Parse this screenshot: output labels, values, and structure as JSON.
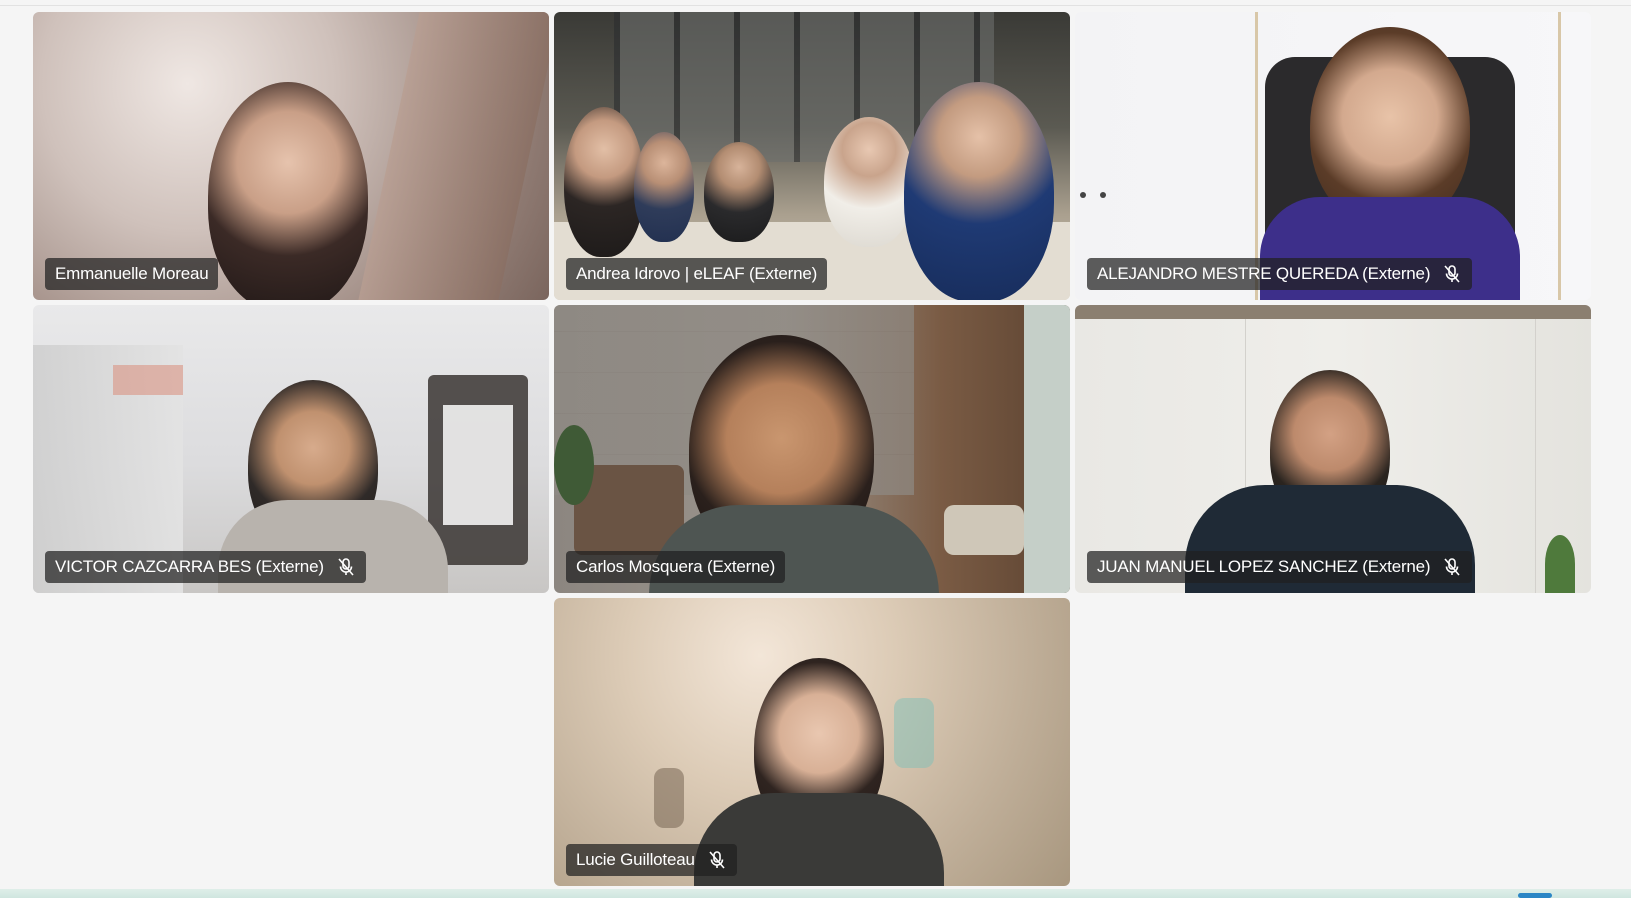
{
  "participants": [
    {
      "name": "Emmanuelle Moreau",
      "muted": false
    },
    {
      "name": "Andrea Idrovo | eLEAF (Externe)",
      "muted": false
    },
    {
      "name": "ALEJANDRO MESTRE QUEREDA (Externe)",
      "muted": true
    },
    {
      "name": "VICTOR CAZCARRA BES (Externe)",
      "muted": true
    },
    {
      "name": "Carlos Mosquera (Externe)",
      "muted": false
    },
    {
      "name": "JUAN MANUEL LOPEZ SANCHEZ (Externe)",
      "muted": true
    },
    {
      "name": "Lucie Guilloteau",
      "muted": true
    }
  ],
  "icons": {
    "mic_muted": "mic-off-icon"
  },
  "colors": {
    "stage_background": "#f5f5f5",
    "name_tag_background": "#202020",
    "name_tag_text": "#ffffff",
    "taskbar_accent": "#2b86c5"
  }
}
